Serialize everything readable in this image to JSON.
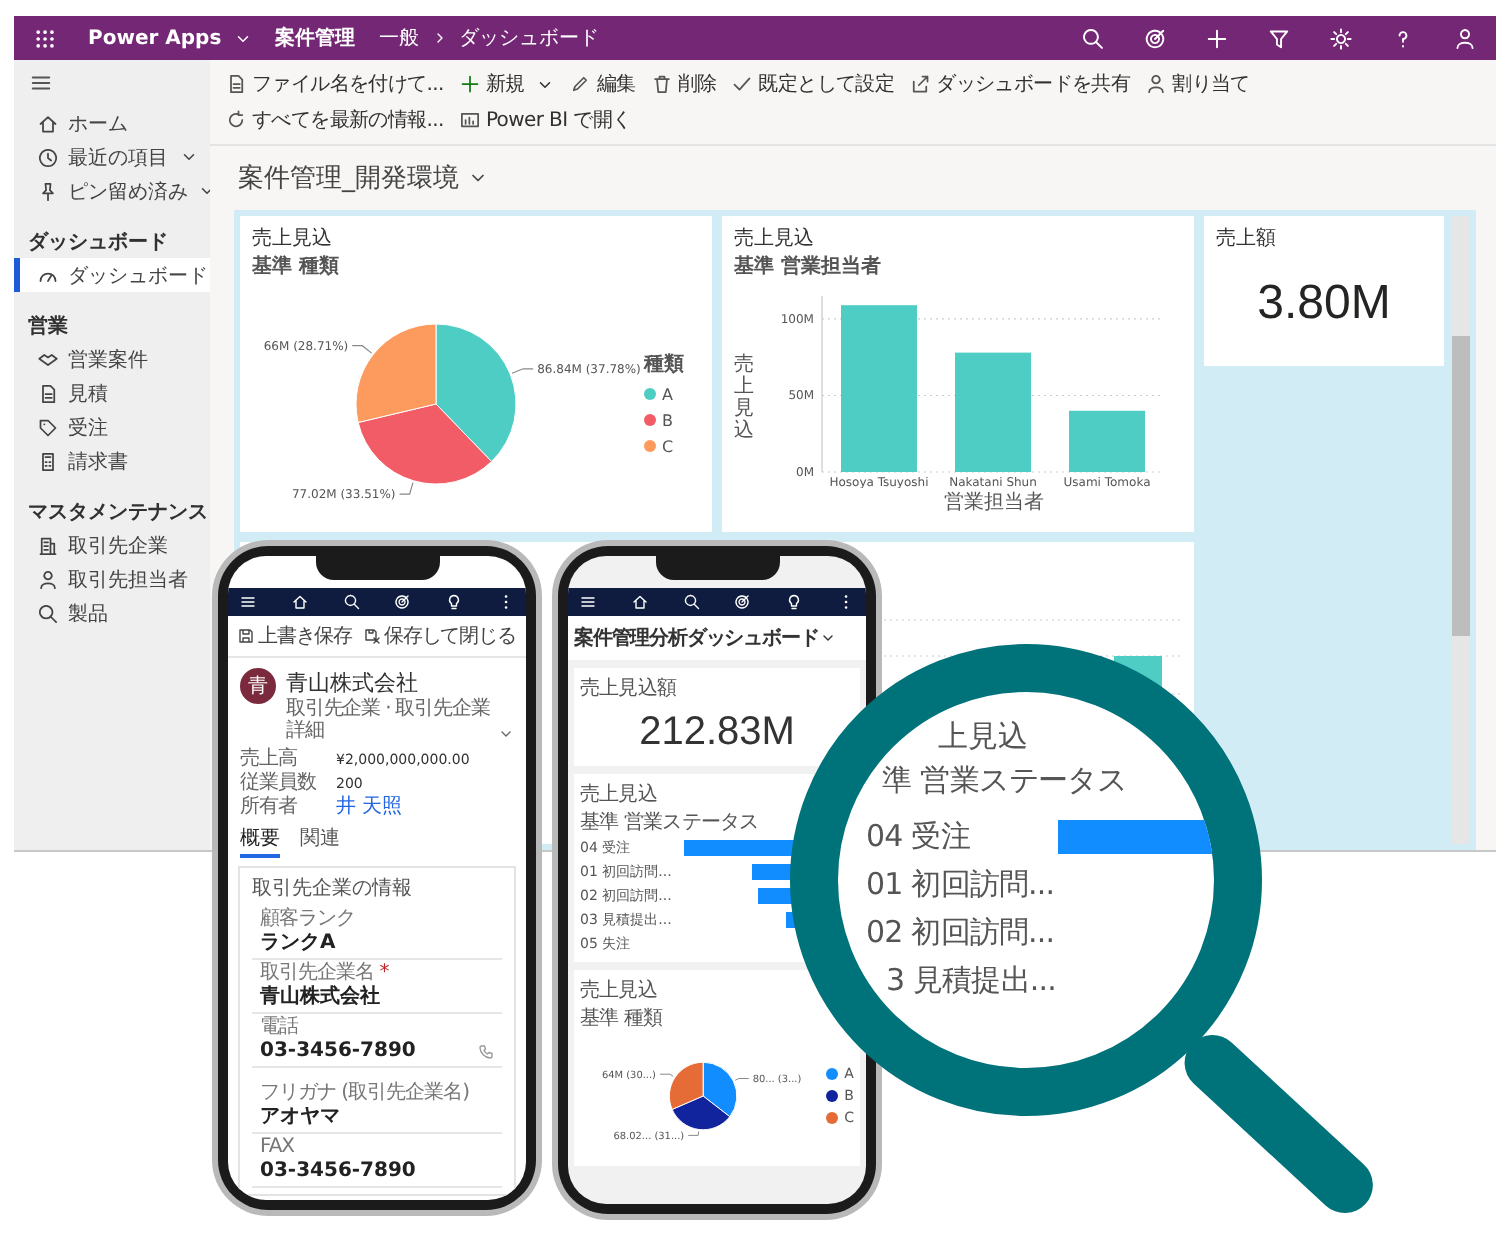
{
  "app_bar": {
    "app_name": "Power Apps",
    "area": "案件管理",
    "breadcrumb": [
      "一般",
      "ダッシュボード"
    ]
  },
  "commands": [
    {
      "kind": "save-as",
      "label": "ファイル名を付けて...",
      "menu": false
    },
    {
      "kind": "new",
      "label": "新規",
      "menu": true
    },
    {
      "kind": "edit",
      "label": "編集",
      "menu": false
    },
    {
      "kind": "delete",
      "label": "削除",
      "menu": false
    },
    {
      "kind": "set-default",
      "label": "既定として設定",
      "menu": false
    },
    {
      "kind": "share",
      "label": "ダッシュボードを共有",
      "menu": false
    },
    {
      "kind": "assign",
      "label": "割り当て",
      "menu": false
    },
    {
      "kind": "refresh",
      "label": "すべてを最新の情報...",
      "menu": false
    },
    {
      "kind": "power-bi",
      "label": "Power BI で開く",
      "menu": false
    }
  ],
  "sidebar": {
    "top_items": [
      {
        "kind": "home",
        "label": "ホーム",
        "expandable": false,
        "selected": false
      },
      {
        "kind": "recent",
        "label": "最近の項目",
        "expandable": true,
        "selected": false
      },
      {
        "kind": "pinned",
        "label": "ピン留め済み",
        "expandable": true,
        "selected": false
      }
    ],
    "sections": [
      {
        "title": "ダッシュボード",
        "items": [
          {
            "kind": "dashboard",
            "label": "ダッシュボード",
            "selected": true
          }
        ]
      },
      {
        "title": "営業",
        "items": [
          {
            "kind": "opportunity",
            "label": "営業案件",
            "selected": false
          },
          {
            "kind": "quote",
            "label": "見積",
            "selected": false
          },
          {
            "kind": "order",
            "label": "受注",
            "selected": false
          },
          {
            "kind": "invoice",
            "label": "請求書",
            "selected": false
          }
        ]
      },
      {
        "title": "マスタメンテナンス",
        "items": [
          {
            "kind": "account",
            "label": "取引先企業",
            "selected": false
          },
          {
            "kind": "contact",
            "label": "取引先担当者",
            "selected": false
          },
          {
            "kind": "product",
            "label": "製品",
            "selected": false
          }
        ]
      }
    ]
  },
  "dashboard_title": "案件管理_開発環境",
  "cards": {
    "pie": {
      "title": "売上見込",
      "subtitle": "基準 種類",
      "legend_title": "種類",
      "legend": [
        {
          "color": "#4ecdc4"
        },
        {
          "color": "#f25c66"
        },
        {
          "color": "#fd9a5e"
        }
      ],
      "chart_data": {
        "type": "pie",
        "categories": [
          "A",
          "B",
          "C"
        ],
        "values": [
          37.78,
          33.51,
          28.71
        ],
        "data_labels": true,
        "value_labels": [
          "86.84M (37.78%)",
          "77.02M (33.51%)",
          "66M (28.71%)"
        ]
      }
    },
    "bar": {
      "title": "売上見込",
      "subtitle": "基準 営業担当者",
      "chart_data": {
        "type": "bar",
        "xlabel": "営業担当者",
        "categories": [
          "Hosoya Tsuyoshi",
          "Nakatani Shun",
          "Usami Tomoka"
        ],
        "series": [
          {
            "name": "売上見込",
            "color": "#4ecdc4",
            "values": [
              109,
              78,
              40
            ]
          }
        ],
        "ylim": [
          0,
          115
        ],
        "yticks": [
          {
            "value": 0,
            "label": "0M"
          },
          {
            "value": 50,
            "label": "50M"
          },
          {
            "value": 100,
            "label": "100M"
          }
        ]
      }
    },
    "kpi": {
      "title": "売上額",
      "value": "3.80M"
    }
  },
  "phones": {
    "record": {
      "commands": [
        {
          "kind": "save",
          "label": "上書き保存"
        },
        {
          "kind": "save-close",
          "label": "保存して閉じる"
        }
      ],
      "avatar": "青",
      "name": "青山株式会社",
      "subtitle": "取引先企業 · 取引先企業詳細",
      "summary": [
        {
          "label": "売上高",
          "value": "¥2,000,000,000.00",
          "kind": "text"
        },
        {
          "label": "従業員数",
          "value": "200",
          "kind": "text"
        },
        {
          "label": "所有者",
          "value": "井 天照",
          "kind": "link"
        }
      ],
      "tabs": [
        {
          "label": "概要",
          "selected": true
        },
        {
          "label": "関連",
          "selected": false
        }
      ],
      "section_title": "取引先企業の情報",
      "field_groups": [
        [
          {
            "label": "顧客ランク",
            "value": "ランクA",
            "kind": "text"
          },
          {
            "label": "取引先企業名",
            "required_mark": "*",
            "value": "青山株式会社",
            "kind": "text"
          },
          {
            "label": "電話",
            "value": "03-3456-7890",
            "kind": "phone"
          }
        ],
        [
          {
            "label": "フリガナ (取引先企業名)",
            "value": "アオヤマ",
            "kind": "text"
          },
          {
            "label": "FAX",
            "value": "03-3456-7890",
            "kind": "text"
          }
        ]
      ]
    },
    "dashboard": {
      "title": "案件管理分析ダッシュボード",
      "kpi": {
        "title": "売上見込額",
        "value": "212.83M"
      },
      "status_chart": {
        "title": "売上見込",
        "subtitle": "基準 営業ステータス",
        "rows": [
          "04 受注",
          "01 初回訪問...",
          "02 初回訪問...",
          "03 見積提出...",
          "05 失注"
        ]
      },
      "type_chart": {
        "title": "売上見込",
        "subtitle": "基準 種類",
        "slice_labels": [
          "64M (30...)",
          "80... (3...)",
          "68.02... (31...)"
        ],
        "legend": [
          {
            "label": "A",
            "color": "#118dff"
          },
          {
            "label": "B",
            "color": "#12239e"
          },
          {
            "label": "C",
            "color": "#e66c37"
          }
        ]
      }
    }
  },
  "magnifier": {
    "title": "上見込",
    "subtitle": "準 営業ステータス",
    "rows": [
      {
        "label": "04 受注",
        "bar_visible": true
      },
      {
        "label": "01 初回訪問...",
        "bar_visible": false
      },
      {
        "label": "02 初回訪問...",
        "bar_visible": false
      },
      {
        "label": "3 見積提出...",
        "bar_visible": false
      }
    ]
  }
}
